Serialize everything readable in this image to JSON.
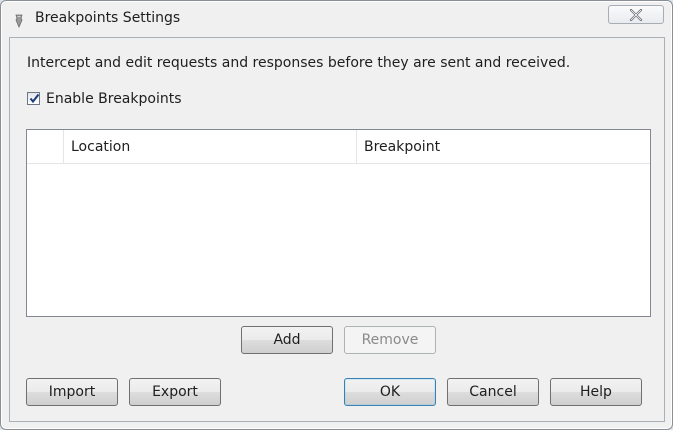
{
  "window": {
    "title": "Breakpoints Settings",
    "icon": "fiddler-app-icon",
    "close_icon": "close-icon"
  },
  "description": "Intercept and edit requests and responses before they are sent and received.",
  "enable_breakpoints": {
    "label": "Enable Breakpoints",
    "checked": true
  },
  "list": {
    "columns": [
      "",
      "Location",
      "Breakpoint"
    ],
    "rows": []
  },
  "buttons": {
    "add": "Add",
    "remove": "Remove",
    "import": "Import",
    "export": "Export",
    "ok": "OK",
    "cancel": "Cancel",
    "help": "Help"
  },
  "colors": {
    "accent_border": "#3c7fb1",
    "disabled_text": "#8a8a8a"
  }
}
